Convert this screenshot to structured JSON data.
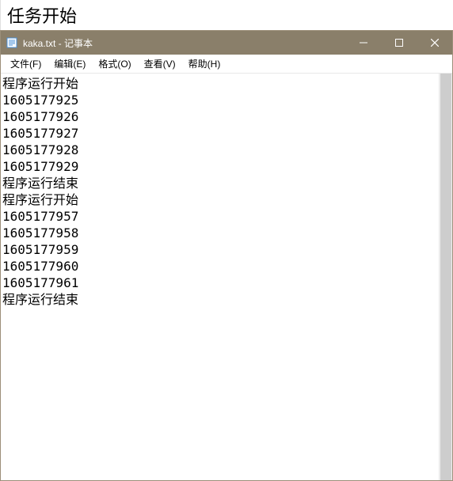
{
  "outer": {
    "header_text": "任务开始"
  },
  "window": {
    "title": "kaka.txt - 记事本"
  },
  "menu": {
    "items": [
      "文件(F)",
      "编辑(E)",
      "格式(O)",
      "查看(V)",
      "帮助(H)"
    ]
  },
  "content": {
    "lines": [
      "程序运行开始",
      "1605177925",
      "1605177926",
      "1605177927",
      "1605177928",
      "1605177929",
      "程序运行结束",
      "程序运行开始",
      "1605177957",
      "1605177958",
      "1605177959",
      "1605177960",
      "1605177961",
      "程序运行结束"
    ]
  },
  "controls": {
    "minimize": "─",
    "maximize": "☐",
    "close": "✕"
  }
}
